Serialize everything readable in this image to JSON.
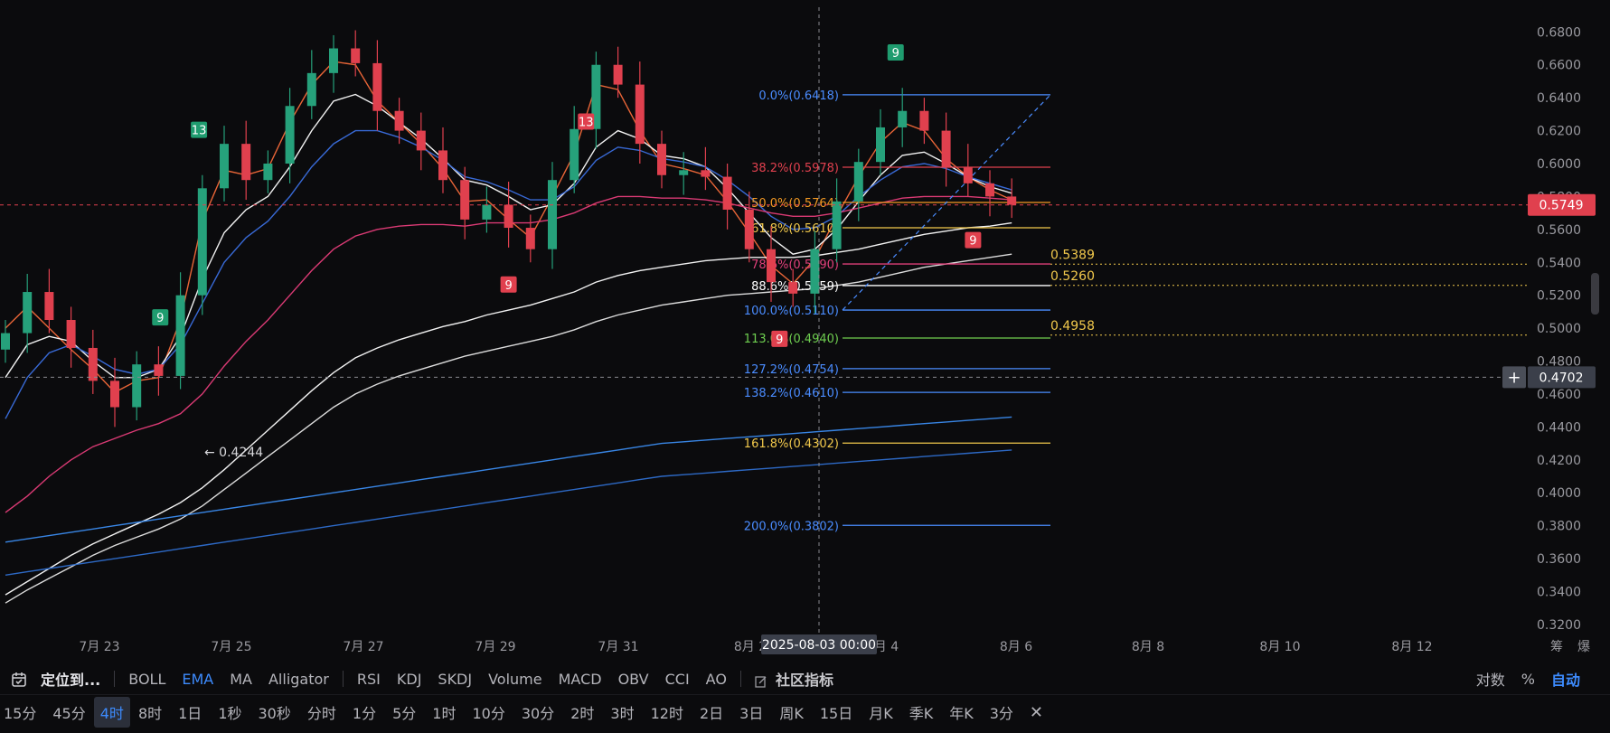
{
  "chart_data": {
    "type": "candlestick",
    "timeframe": "4时",
    "x_tick_labels": [
      "7月 23",
      "7月 25",
      "7月 27",
      "7月 29",
      "7月 31",
      "8月 2",
      "8月 4",
      "8月 6",
      "8月 8",
      "8月 10",
      "8月 12"
    ],
    "y_ticks": [
      "0.6800",
      "0.6600",
      "0.6400",
      "0.6200",
      "0.6000",
      "0.5800",
      "0.5600",
      "0.5400",
      "0.5200",
      "0.5000",
      "0.4800",
      "0.4600",
      "0.4400",
      "0.4200",
      "0.4000",
      "0.3800",
      "0.3600",
      "0.3400",
      "0.3200"
    ],
    "ylim": [
      0.315,
      0.695
    ],
    "current_price": "0.5749",
    "cursor_price": "0.4702",
    "cursor_time": "2025-08-03 00:00",
    "low_annotation": "← 0.4244",
    "fib_levels": [
      {
        "label": "0.0%(0.6418)",
        "value": 0.6418,
        "color": "#4a8cff"
      },
      {
        "label": "38.2%(0.5978)",
        "value": 0.5978,
        "color": "#e0404e"
      },
      {
        "label": "50.0%(0.5764)",
        "value": 0.5764,
        "color": "#f59a23"
      },
      {
        "label": "61.8%(0.5610)",
        "value": 0.561,
        "color": "#f2c94c"
      },
      {
        "label": "78.6%(0.5390)",
        "value": 0.539,
        "color": "#e0407a"
      },
      {
        "label": "88.6%(0.5259)",
        "value": 0.5259,
        "color": "#ffffff"
      },
      {
        "label": "100.0%(0.5110)",
        "value": 0.511,
        "color": "#4a8cff"
      },
      {
        "label": "113.0%(0.4940)",
        "value": 0.494,
        "color": "#6fcf50"
      },
      {
        "label": "127.2%(0.4754)",
        "value": 0.4754,
        "color": "#4a8cff"
      },
      {
        "label": "138.2%(0.4610)",
        "value": 0.461,
        "color": "#4a8cff"
      },
      {
        "label": "161.8%(0.4302)",
        "value": 0.4302,
        "color": "#f2c94c"
      },
      {
        "label": "200.0%(0.3802)",
        "value": 0.3802,
        "color": "#4a8cff"
      }
    ],
    "side_levels": [
      {
        "label": "0.5389",
        "value": 0.5389
      },
      {
        "label": "0.5260",
        "value": 0.526
      },
      {
        "label": "0.4958",
        "value": 0.4958
      }
    ],
    "td_markers": [
      {
        "label": "9",
        "i": 4,
        "pos": "above",
        "color": "#1f9c6f"
      },
      {
        "label": "13",
        "i": 5,
        "pos": "above",
        "color": "#1f9c6f"
      },
      {
        "label": "9",
        "i": 13,
        "pos": "below",
        "color": "#e0404e"
      },
      {
        "label": "13",
        "i": 15,
        "pos": "below",
        "color": "#e0404e"
      },
      {
        "label": "9",
        "i": 20,
        "pos": "below",
        "color": "#e0404e"
      },
      {
        "label": "9",
        "i": 23,
        "pos": "above",
        "color": "#1f9c6f"
      },
      {
        "label": "9",
        "i": 25,
        "pos": "below",
        "color": "#e0404e"
      }
    ],
    "candles": [
      0.497,
      0.522,
      0.505,
      0.488,
      0.468,
      0.452,
      0.478,
      0.471,
      0.52,
      0.585,
      0.612,
      0.59,
      0.6,
      0.635,
      0.655,
      0.67,
      0.661,
      0.632,
      0.62,
      0.608,
      0.59,
      0.566,
      0.575,
      0.561,
      0.548,
      0.59,
      0.621,
      0.66,
      0.648,
      0.612,
      0.593,
      0.596,
      0.592,
      0.572,
      0.548,
      0.528,
      0.521,
      0.548,
      0.577,
      0.601,
      0.622,
      0.632,
      0.62,
      0.598,
      0.588,
      0.58,
      0.575
    ],
    "series": [
      {
        "name": "",
        "color": "#f56a3a",
        "values": [
          0.5,
          0.513,
          0.5,
          0.487,
          0.475,
          0.461,
          0.468,
          0.47,
          0.505,
          0.565,
          0.596,
          0.593,
          0.597,
          0.625,
          0.648,
          0.662,
          0.66,
          0.638,
          0.625,
          0.612,
          0.597,
          0.577,
          0.578,
          0.566,
          0.555,
          0.58,
          0.606,
          0.648,
          0.645,
          0.62,
          0.6,
          0.597,
          0.593,
          0.577,
          0.558,
          0.538,
          0.527,
          0.542,
          0.568,
          0.592,
          0.613,
          0.625,
          0.62,
          0.603,
          0.592,
          0.584,
          0.578
        ]
      },
      {
        "name": "",
        "color": "#ffffff",
        "values": [
          0.47,
          0.49,
          0.495,
          0.492,
          0.48,
          0.47,
          0.47,
          0.475,
          0.495,
          0.53,
          0.558,
          0.572,
          0.58,
          0.598,
          0.62,
          0.638,
          0.642,
          0.635,
          0.625,
          0.615,
          0.603,
          0.59,
          0.587,
          0.58,
          0.572,
          0.575,
          0.588,
          0.61,
          0.62,
          0.615,
          0.605,
          0.603,
          0.598,
          0.585,
          0.57,
          0.555,
          0.545,
          0.548,
          0.56,
          0.577,
          0.593,
          0.605,
          0.607,
          0.6,
          0.592,
          0.586,
          0.582
        ]
      },
      {
        "name": "",
        "color": "#3b6fe0",
        "values": [
          0.445,
          0.47,
          0.485,
          0.49,
          0.483,
          0.475,
          0.472,
          0.475,
          0.49,
          0.515,
          0.54,
          0.555,
          0.565,
          0.58,
          0.598,
          0.612,
          0.62,
          0.62,
          0.616,
          0.61,
          0.602,
          0.592,
          0.589,
          0.584,
          0.578,
          0.578,
          0.586,
          0.602,
          0.61,
          0.608,
          0.603,
          0.601,
          0.598,
          0.59,
          0.58,
          0.568,
          0.56,
          0.561,
          0.568,
          0.58,
          0.59,
          0.598,
          0.6,
          0.597,
          0.592,
          0.588,
          0.584
        ]
      },
      {
        "name": "",
        "color": "#e63d7a",
        "values": [
          0.388,
          0.398,
          0.41,
          0.42,
          0.428,
          0.433,
          0.438,
          0.442,
          0.448,
          0.46,
          0.477,
          0.492,
          0.505,
          0.52,
          0.535,
          0.548,
          0.556,
          0.56,
          0.562,
          0.563,
          0.563,
          0.562,
          0.564,
          0.564,
          0.564,
          0.566,
          0.57,
          0.576,
          0.58,
          0.58,
          0.579,
          0.579,
          0.578,
          0.576,
          0.573,
          0.57,
          0.568,
          0.568,
          0.57,
          0.573,
          0.576,
          0.579,
          0.58,
          0.58,
          0.58,
          0.579,
          0.578
        ]
      },
      {
        "name": "",
        "color": "#ffffff",
        "values": [
          0.338,
          0.346,
          0.354,
          0.362,
          0.369,
          0.375,
          0.381,
          0.387,
          0.394,
          0.403,
          0.414,
          0.426,
          0.438,
          0.45,
          0.462,
          0.473,
          0.482,
          0.488,
          0.493,
          0.497,
          0.501,
          0.504,
          0.508,
          0.511,
          0.514,
          0.518,
          0.522,
          0.528,
          0.532,
          0.535,
          0.537,
          0.539,
          0.541,
          0.542,
          0.543,
          0.543,
          0.543,
          0.544,
          0.546,
          0.548,
          0.551,
          0.554,
          0.557,
          0.559,
          0.561,
          0.562,
          0.564
        ]
      },
      {
        "name": "",
        "color": "#e8e8e8",
        "values": [
          0.333,
          0.341,
          0.348,
          0.355,
          0.362,
          0.368,
          0.373,
          0.378,
          0.384,
          0.392,
          0.402,
          0.412,
          0.422,
          0.432,
          0.442,
          0.452,
          0.46,
          0.466,
          0.471,
          0.475,
          0.479,
          0.483,
          0.486,
          0.489,
          0.492,
          0.495,
          0.499,
          0.504,
          0.508,
          0.511,
          0.514,
          0.516,
          0.518,
          0.52,
          0.521,
          0.522,
          0.523,
          0.524,
          0.526,
          0.528,
          0.531,
          0.534,
          0.537,
          0.539,
          0.541,
          0.543,
          0.545
        ]
      },
      {
        "name": "",
        "color": "#3b8cf0",
        "values": [
          0.37,
          0.372,
          0.374,
          0.376,
          0.378,
          0.38,
          0.382,
          0.384,
          0.386,
          0.388,
          0.39,
          0.392,
          0.394,
          0.396,
          0.398,
          0.4,
          0.402,
          0.404,
          0.406,
          0.408,
          0.41,
          0.412,
          0.414,
          0.416,
          0.418,
          0.42,
          0.422,
          0.424,
          0.426,
          0.428,
          0.43,
          0.431,
          0.432,
          0.433,
          0.434,
          0.435,
          0.436,
          0.437,
          0.438,
          0.439,
          0.44,
          0.441,
          0.442,
          0.443,
          0.444,
          0.445,
          0.446
        ]
      },
      {
        "name": "",
        "color": "#2f6fd0",
        "values": [
          0.35,
          0.352,
          0.354,
          0.356,
          0.358,
          0.36,
          0.362,
          0.364,
          0.366,
          0.368,
          0.37,
          0.372,
          0.374,
          0.376,
          0.378,
          0.38,
          0.382,
          0.384,
          0.386,
          0.388,
          0.39,
          0.392,
          0.394,
          0.396,
          0.398,
          0.4,
          0.402,
          0.404,
          0.406,
          0.408,
          0.41,
          0.411,
          0.412,
          0.413,
          0.414,
          0.415,
          0.416,
          0.417,
          0.418,
          0.419,
          0.42,
          0.421,
          0.422,
          0.423,
          0.424,
          0.425,
          0.426
        ]
      }
    ]
  },
  "indicators": {
    "locate_label": "定位到...",
    "main": [
      "BOLL",
      "EMA",
      "MA",
      "Alligator"
    ],
    "sub": [
      "RSI",
      "KDJ",
      "SKDJ",
      "Volume",
      "MACD",
      "OBV",
      "CCI",
      "AO"
    ],
    "community": "社区指标",
    "right": [
      "对数",
      "%",
      "自动"
    ]
  },
  "timeframes": [
    "15分",
    "45分",
    "4时",
    "8时",
    "1日",
    "1秒",
    "30秒",
    "分时",
    "1分",
    "5分",
    "1时",
    "10分",
    "30分",
    "2时",
    "3时",
    "12时",
    "2日",
    "3日",
    "周K",
    "15日",
    "月K",
    "季K",
    "年K",
    "3分"
  ],
  "axis_right_labels": [
    "筹",
    "爆"
  ]
}
